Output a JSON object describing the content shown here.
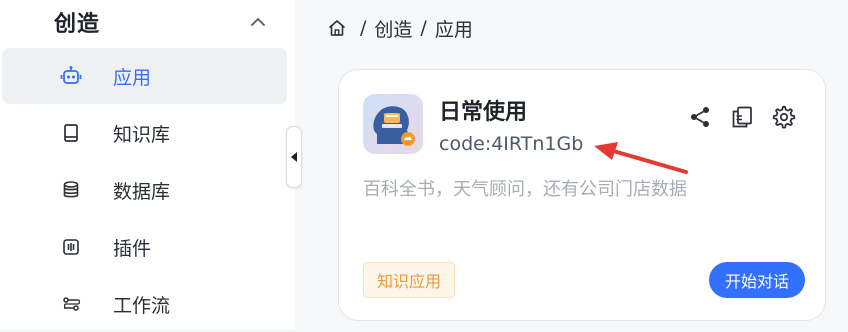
{
  "sidebar": {
    "section_title": "创造",
    "items": [
      {
        "label": "应用",
        "icon": "robot-icon",
        "active": true
      },
      {
        "label": "知识库",
        "icon": "book-icon",
        "active": false
      },
      {
        "label": "数据库",
        "icon": "database-icon",
        "active": false
      },
      {
        "label": "插件",
        "icon": "plugin-icon",
        "active": false
      },
      {
        "label": "工作流",
        "icon": "workflow-icon",
        "active": false
      }
    ]
  },
  "breadcrumb": {
    "sep": "/",
    "items": [
      "创造",
      "应用"
    ]
  },
  "card": {
    "name": "日常使用",
    "code": "code:4IRTn1Gb",
    "description": "百科全书，天气顾问，还有公司门店数据",
    "tag": "知识应用",
    "chat_button": "开始对话"
  },
  "colors": {
    "accent": "#3370ff",
    "tag_text": "#e89a3c",
    "annotation_arrow": "#e53935"
  }
}
